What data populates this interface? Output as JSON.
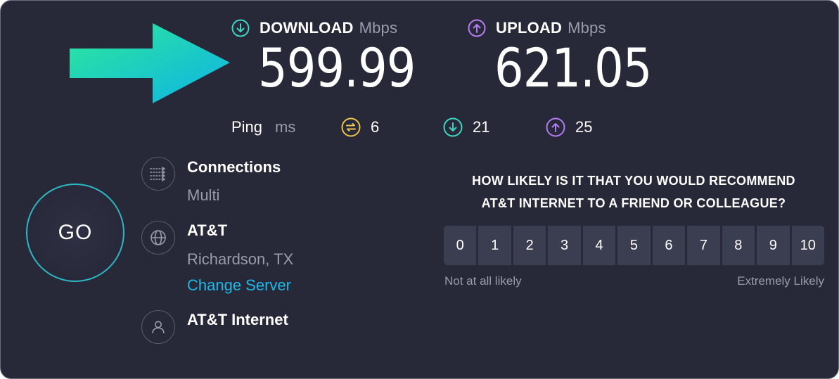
{
  "download": {
    "label": "DOWNLOAD",
    "unit": "Mbps",
    "value": "599.99",
    "icon": "download-arrow-icon",
    "color": "#3fd6c4"
  },
  "upload": {
    "label": "UPLOAD",
    "unit": "Mbps",
    "value": "621.05",
    "icon": "upload-arrow-icon",
    "color": "#b57bf0"
  },
  "ping": {
    "label": "Ping",
    "unit": "ms",
    "idle": "6",
    "download": "21",
    "upload": "25",
    "idle_color": "#e8c64d"
  },
  "go_button": {
    "label": "GO",
    "ring_color": "#2fb6c3"
  },
  "connections": {
    "title": "Connections",
    "value": "Multi",
    "icon": "connections-icon"
  },
  "server": {
    "title": "AT&T",
    "location": "Richardson, TX",
    "change_label": "Change Server",
    "icon": "globe-icon"
  },
  "provider": {
    "title": "AT&T Internet",
    "icon": "user-icon"
  },
  "survey": {
    "question_line1": "HOW LIKELY IS IT THAT YOU WOULD RECOMMEND",
    "question_line2": "AT&T INTERNET TO A FRIEND OR COLLEAGUE?",
    "scale": [
      "0",
      "1",
      "2",
      "3",
      "4",
      "5",
      "6",
      "7",
      "8",
      "9",
      "10"
    ],
    "low_label": "Not at all likely",
    "high_label": "Extremely Likely"
  },
  "arrow": {
    "colors": [
      "#2ee89a",
      "#11b7e0"
    ],
    "icon": "right-arrow-graphic"
  }
}
